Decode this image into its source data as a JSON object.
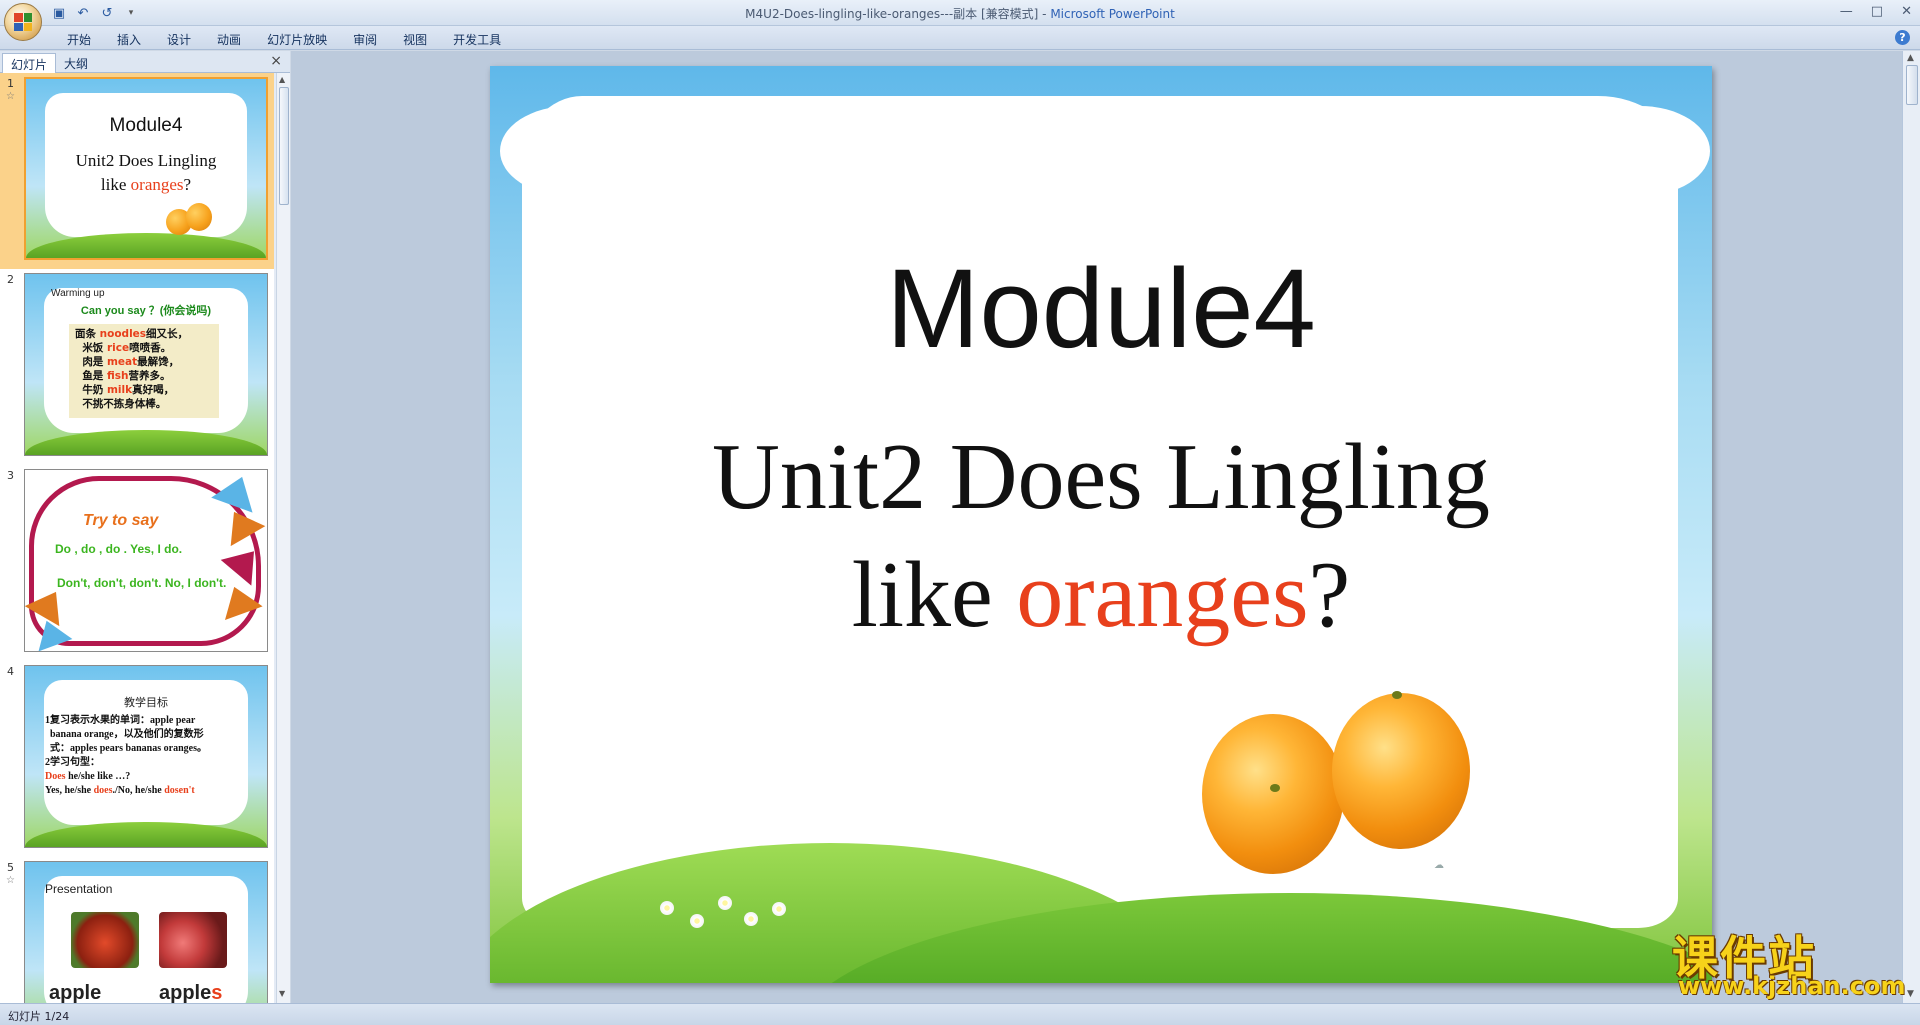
{
  "window": {
    "title": "M4U2-Does-lingling-like-oranges---副本 [兼容模式]",
    "app": "Microsoft PowerPoint",
    "separator": " - "
  },
  "ribbon": {
    "tabs": [
      "开始",
      "插入",
      "设计",
      "动画",
      "幻灯片放映",
      "审阅",
      "视图",
      "开发工具"
    ]
  },
  "left_pane": {
    "tabs": [
      "幻灯片",
      "大纲"
    ],
    "close": "×"
  },
  "thumbnails": {
    "s1": {
      "num": "1",
      "title": "Module4",
      "sub_a": "Unit2  Does Lingling",
      "sub_b": "like ",
      "sub_red": "oranges",
      "sub_end": "?"
    },
    "s2": {
      "num": "2",
      "heading": "Warming up",
      "green": "Can you say  ？(你会说吗)",
      "lines": [
        {
          "a": "面条 ",
          "w": "noodles",
          "b": "细又长，"
        },
        {
          "a": "米饭 ",
          "w": "rice",
          "b": "喷喷香。"
        },
        {
          "a": "肉是 ",
          "w": "meat",
          "b": "最解馋，"
        },
        {
          "a": "鱼是 ",
          "w": "fish",
          "b": "营养多。"
        },
        {
          "a": "牛奶 ",
          "w": "milk",
          "b": "真好喝，"
        },
        {
          "a": "不挑不拣身体棒。",
          "w": "",
          "b": ""
        }
      ]
    },
    "s3": {
      "num": "3",
      "title": "Try to say",
      "line1": "Do , do , do .  Yes,  I do.",
      "line2": "Don't, don't, don't.    No, I don't."
    },
    "s4": {
      "num": "4",
      "title": "教学目标",
      "l1": "1复习表示水果的单词：apple  pear",
      "l2": "banana  orange，以及他们的复数形",
      "l3": "式：apples  pears  bananas  oranges。",
      "l4": "2学习句型：",
      "l5a": "Does",
      "l5b": " he/she like …?",
      "l6a": "Yes, he/she ",
      "l6b": "does",
      "l6c": "./No, he/she ",
      "l6d": "dosen't"
    },
    "s5": {
      "num": "5",
      "title": "Presentation",
      "w1": "apple",
      "w2a": "apple",
      "w2b": "s"
    }
  },
  "slide": {
    "title": "Module4",
    "sub_line1": "Unit2  Does Lingling",
    "sub_line2_a": "like ",
    "sub_line2_red": "oranges",
    "sub_line2_end": "?"
  },
  "site_logo": {
    "big": "课件站",
    "url": "www.kjzhan.com"
  },
  "status": {
    "text": "幻灯片 1/24"
  },
  "colors": {
    "accent_red": "#e8401c",
    "selected_thumb": "#fbd28a",
    "green_text": "#3bb51f"
  }
}
